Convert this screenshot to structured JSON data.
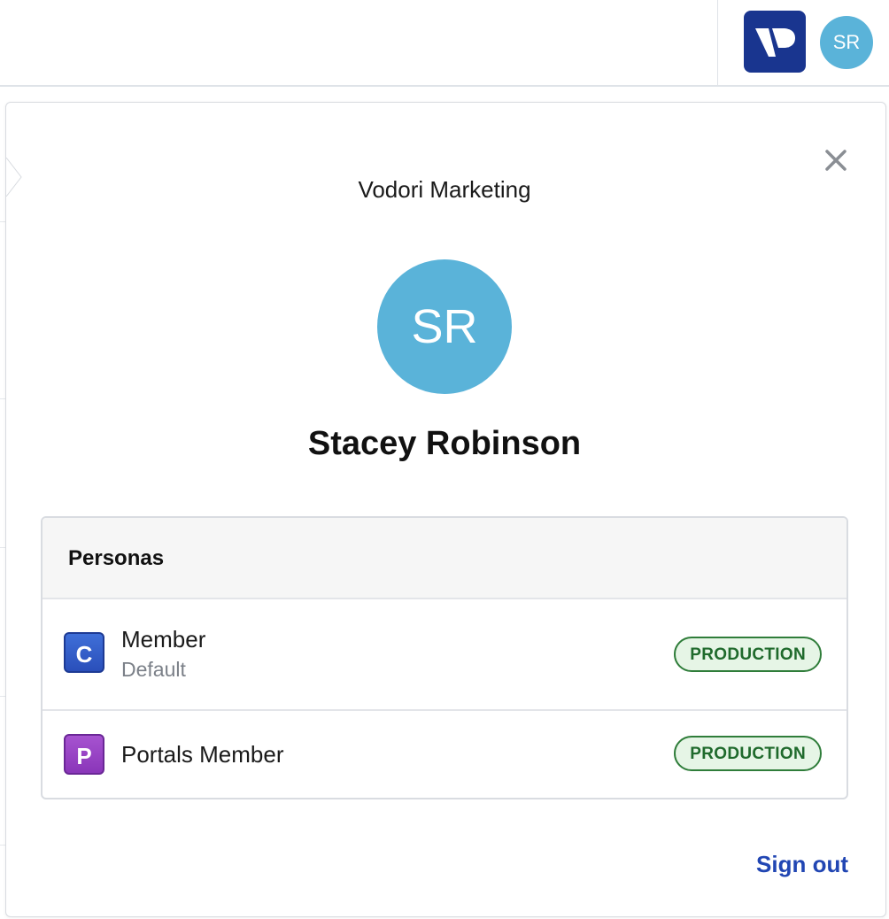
{
  "header": {
    "logo_icon": "vodori-logo-icon",
    "avatar_initials": "SR",
    "avatar_color": "#5ab3d9",
    "logo_color": "#19358f"
  },
  "profile_popover": {
    "org_name": "Vodori Marketing",
    "avatar_initials": "SR",
    "user_name": "Stacey Robinson",
    "close_icon": "close-icon",
    "personas": {
      "title": "Personas",
      "items": [
        {
          "badge_letter": "C",
          "badge_color": "#2f58c8",
          "name": "Member",
          "subtitle": "Default",
          "environment": "PRODUCTION"
        },
        {
          "badge_letter": "P",
          "badge_color": "#9a44c6",
          "name": "Portals Member",
          "subtitle": "",
          "environment": "PRODUCTION"
        }
      ]
    },
    "sign_out_label": "Sign out",
    "sign_out_color": "#2146b3",
    "environment_tag_color": "#2f7d3a"
  }
}
